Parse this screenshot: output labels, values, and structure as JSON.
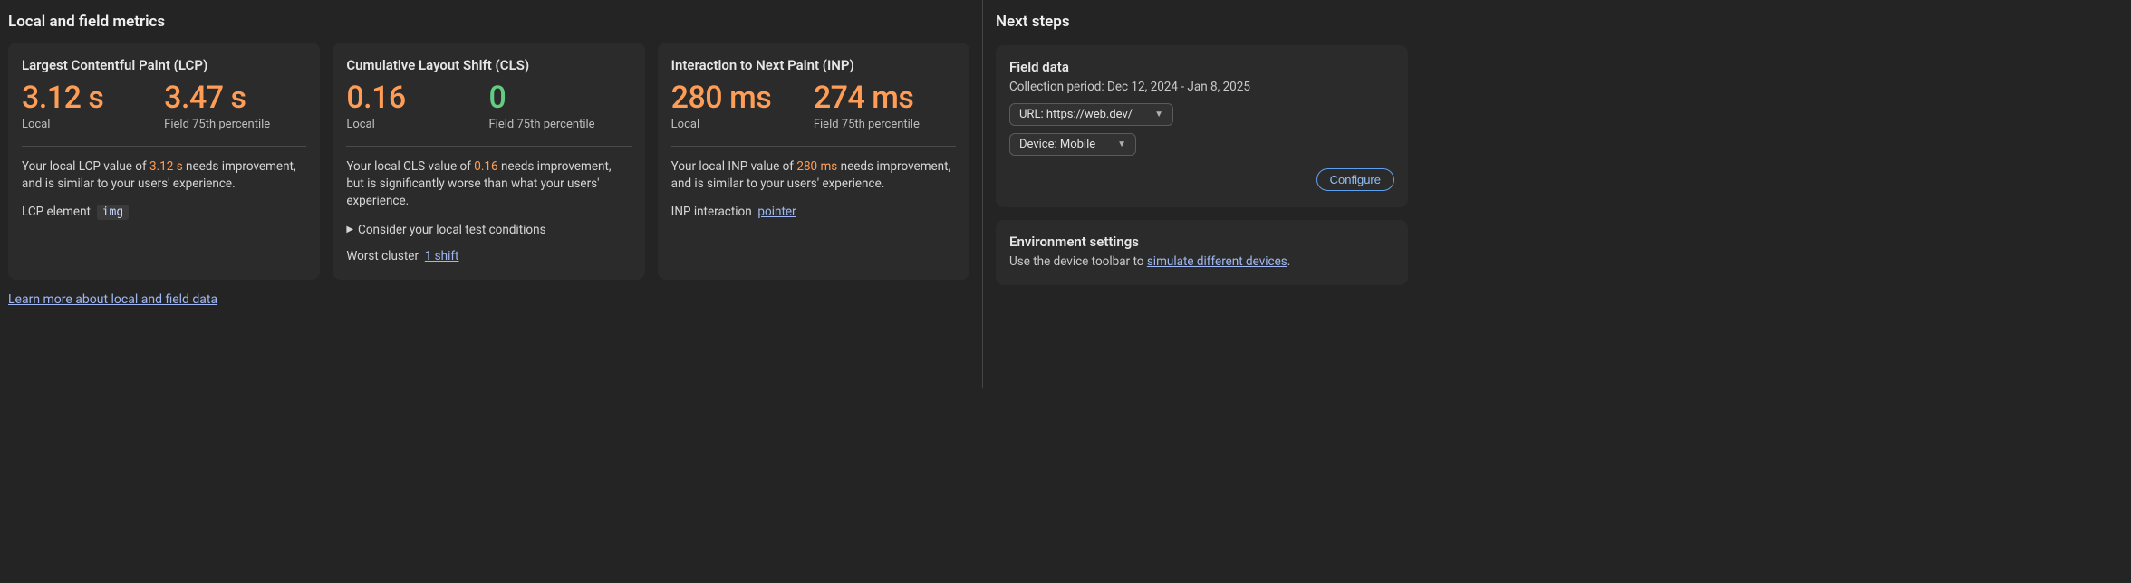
{
  "main": {
    "title": "Local and field metrics",
    "learn_more": "Learn more about local and field data",
    "cards": {
      "lcp": {
        "title": "Largest Contentful Paint (LCP)",
        "local_value": "3.12 s",
        "local_label": "Local",
        "field_value": "3.47 s",
        "field_label": "Field 75th percentile",
        "desc_prefix": "Your local LCP value of ",
        "desc_value": "3.12 s",
        "desc_suffix": " needs improvement, and is similar to your users' experience.",
        "elem_label": "LCP element",
        "elem_chip": "img"
      },
      "cls": {
        "title": "Cumulative Layout Shift (CLS)",
        "local_value": "0.16",
        "local_label": "Local",
        "field_value": "0",
        "field_label": "Field 75th percentile",
        "desc_prefix": "Your local CLS value of ",
        "desc_value": "0.16",
        "desc_suffix": " needs improvement, but is significantly worse than what your users' experience.",
        "expander": "Consider your local test conditions",
        "cluster_label": "Worst cluster",
        "cluster_link": "1 shift"
      },
      "inp": {
        "title": "Interaction to Next Paint (INP)",
        "local_value": "280 ms",
        "local_label": "Local",
        "field_value": "274 ms",
        "field_label": "Field 75th percentile",
        "desc_prefix": "Your local INP value of ",
        "desc_value": "280 ms",
        "desc_suffix": " needs improvement, and is similar to your users' experience.",
        "interaction_label": "INP interaction",
        "interaction_link": "pointer"
      }
    }
  },
  "side": {
    "title": "Next steps",
    "field_data": {
      "title": "Field data",
      "collection_label": "Collection period: Dec 12, 2024 - Jan 8, 2025",
      "url_select": "URL: https://web.dev/",
      "device_select": "Device: Mobile",
      "configure": "Configure"
    },
    "env": {
      "title": "Environment settings",
      "desc_prefix": "Use the device toolbar to ",
      "desc_link": "simulate different devices",
      "desc_suffix": "."
    }
  }
}
